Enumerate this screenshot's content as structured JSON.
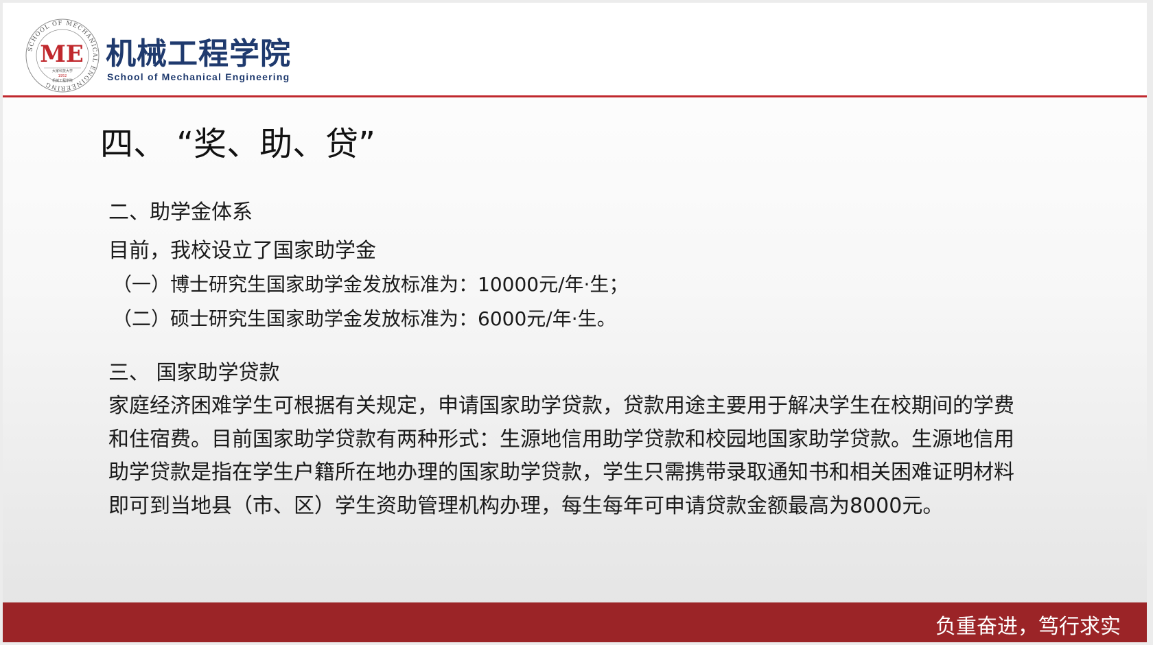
{
  "header": {
    "school_cn": "机械工程学院",
    "school_en": "School of Mechanical Engineering",
    "logo_mark": "ME",
    "logo_ring_text": "SCHOOL OF MECHANICAL ENGINEERING",
    "logo_inner_text": "大家科技大学",
    "logo_year": "1952",
    "logo_inner_text2": "机械工程学院",
    "accent_color": "#c0282d",
    "brand_color": "#1f3a6e"
  },
  "slide": {
    "title": "四、 “奖、助、贷”",
    "section2": {
      "heading": "二、助学金体系",
      "intro": "目前，我校设立了国家助学金",
      "items": [
        "（一）博士研究生国家助学金发放标准为：10000元/年·生；",
        "（二）硕士研究生国家助学金发放标准为：6000元/年·生。"
      ]
    },
    "section3": {
      "heading": "三、 国家助学贷款",
      "body": "家庭经济困难学生可根据有关规定，申请国家助学贷款，贷款用途主要用于解决学生在校期间的学费和住宿费。目前国家助学贷款有两种形式：生源地信用助学贷款和校园地国家助学贷款。生源地信用助学贷款是指在学生户籍所在地办理的国家助学贷款，学生只需携带录取通知书和相关困难证明材料即可到当地县（市、区）学生资助管理机构办理，每生每年可申请贷款金额最高为8000元。"
    }
  },
  "footer": {
    "motto": "负重奋进，笃行求实",
    "bar_color": "#9b2427"
  }
}
